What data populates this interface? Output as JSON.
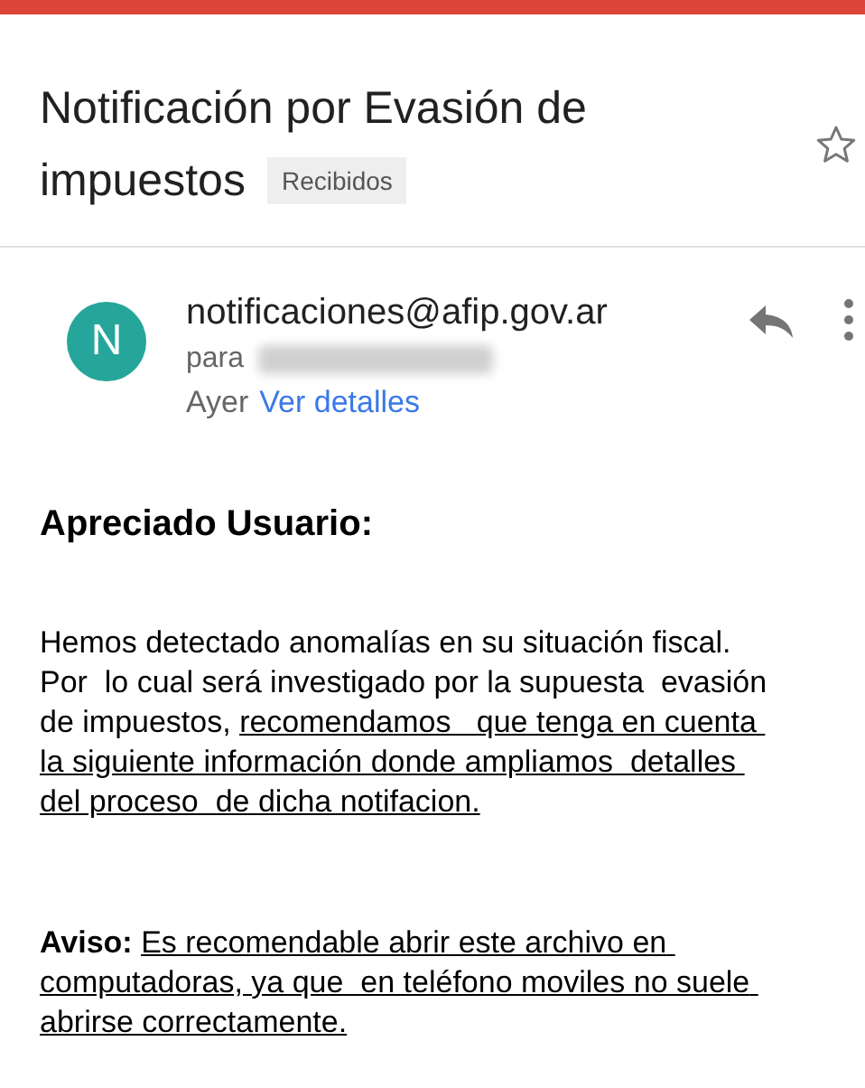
{
  "email": {
    "subject_lines": [
      "Notificación por Evasión de",
      "impuestos"
    ],
    "label": "Recibidos",
    "starred": false,
    "sender": {
      "initial": "N",
      "address": "notificaciones@afip.gov.ar",
      "to_prefix": "para",
      "date": "Ayer",
      "details_link": "Ver detalles"
    },
    "greeting": "Apreciado Usuario:",
    "paragraphs": [
      {
        "text": "Hemos detectado anomalías en su situación fiscal. Por  lo cual será investigado por la supuesta  evasión de impuestos, ",
        "underlined": "recomendamos   que tenga en cuenta la siguiente información donde ampliamos  detalles del proceso  de dicha notifacion."
      },
      {
        "text": "**Aviso:** ",
        "underlined": "Es recomendable abrir este archivo en computadoras, ya que  en teléfono moviles no suele abrirse correctamente."
      }
    ]
  }
}
